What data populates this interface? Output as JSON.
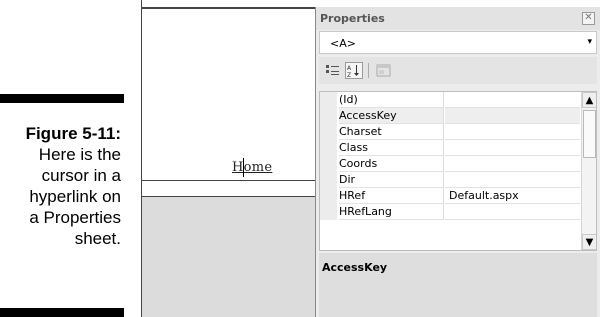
{
  "caption": {
    "figure": "Figure 5-11:",
    "text": "Here is the\ncursor in a\nhyperlink on\na Properties\nsheet."
  },
  "design": {
    "link_text": "Home"
  },
  "properties": {
    "title": "Properties",
    "close_glyph": "✕",
    "selected_element": "<A>",
    "rows": [
      {
        "name": "(Id)",
        "value": ""
      },
      {
        "name": "AccessKey",
        "value": ""
      },
      {
        "name": "Charset",
        "value": ""
      },
      {
        "name": "Class",
        "value": ""
      },
      {
        "name": "Coords",
        "value": ""
      },
      {
        "name": "Dir",
        "value": ""
      },
      {
        "name": "HRef",
        "value": "Default.aspx"
      },
      {
        "name": "HRefLang",
        "value": ""
      }
    ],
    "selected_row": "AccessKey",
    "description_label": "AccessKey"
  },
  "icons": {
    "categorized": "categorized-view-icon",
    "alphabetical": "alphabetical-sort-icon",
    "property_pages": "property-pages-icon",
    "dropdown_arrow": "▾",
    "scroll_up": "▲",
    "scroll_down": "▼"
  },
  "colors": {
    "panel_bg": "#ececec",
    "title_text": "#555555",
    "design_gray": "#dcdcdc"
  }
}
